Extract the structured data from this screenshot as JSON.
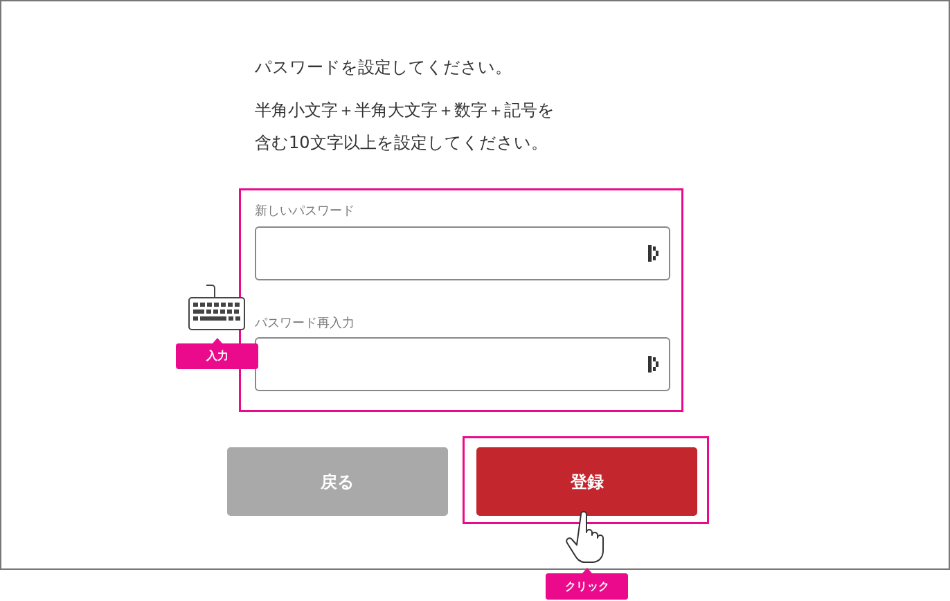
{
  "heading": "パスワードを設定してください。",
  "requirement_lines": [
    "半角小文字＋半角大文字＋数字＋記号を",
    "含む10文字以上を設定してください。"
  ],
  "fields": [
    {
      "label": "新しいパスワード"
    },
    {
      "label": "パスワード再入力"
    }
  ],
  "buttons": [
    {
      "label": "戻る",
      "kind": "secondary"
    },
    {
      "label": "登録",
      "kind": "primary"
    }
  ],
  "annotations": [
    {
      "kind": "input",
      "label": "入力"
    },
    {
      "kind": "click",
      "label": "クリック"
    }
  ]
}
